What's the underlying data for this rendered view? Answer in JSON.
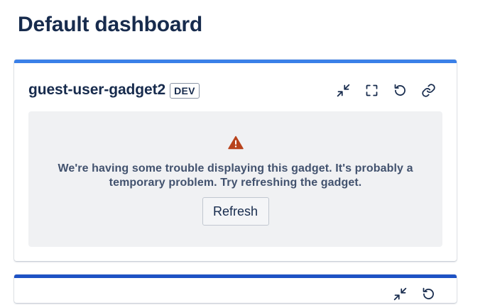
{
  "page": {
    "title": "Default dashboard"
  },
  "gadget": {
    "title": "guest-user-gadget2",
    "badge": "DEV",
    "actions": [
      "minimize-icon",
      "fullscreen-icon",
      "refresh-icon",
      "link-icon"
    ],
    "error": {
      "icon": "warning-icon",
      "message": "We're having some trouble displaying this gadget. It's probably a temporary problem. Try refreshing the gadget.",
      "button_label": "Refresh"
    }
  },
  "colors": {
    "accent_top_1": "#3a80e8",
    "accent_top_2": "#1e52c4",
    "warning": "#b8431c",
    "panel_bg": "#f0f1f3",
    "text": "#172b4d"
  }
}
